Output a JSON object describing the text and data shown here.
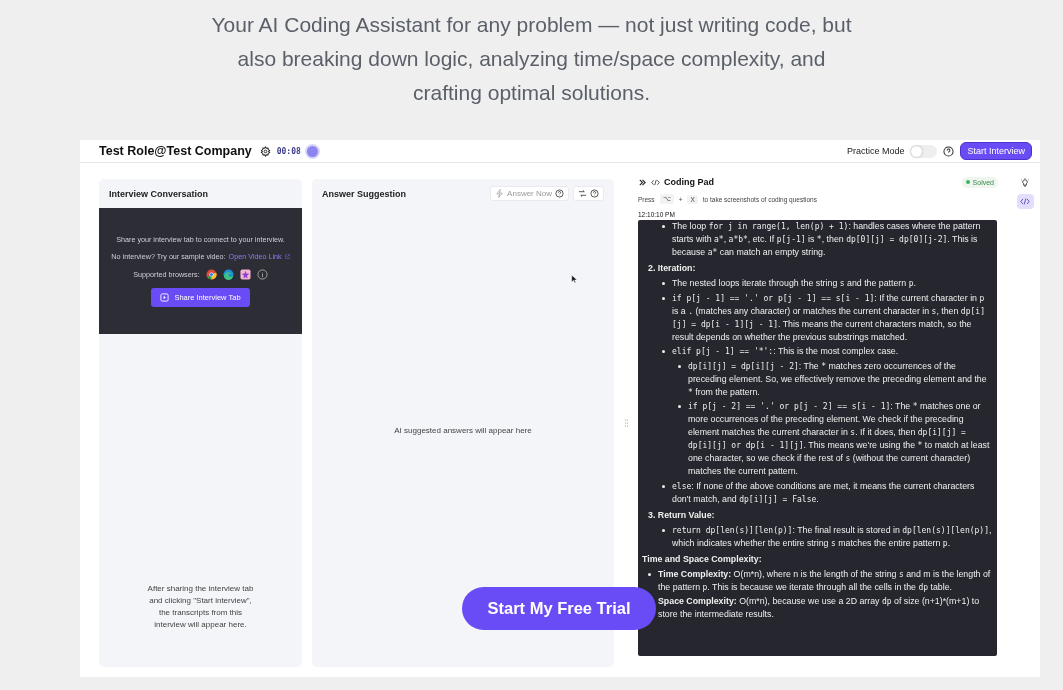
{
  "headline": "Your AI Coding Assistant for any problem — not just writing code, but also breaking down logic, analyzing time/space complexity, and crafting optimal solutions.",
  "top_bar": {
    "title": "Test Role@Test Company",
    "timer": "00:08",
    "recording": true,
    "practice_mode": {
      "label": "Practice Mode",
      "on": false
    },
    "start_button": "Start Interview"
  },
  "conversation": {
    "title": "Interview Conversation",
    "share_prompt": "Share your interview tab to connect to your interview.",
    "sample_prompt": "No interview? Try our sample video:",
    "sample_link": "Open Video Link",
    "browsers_label": "Supported browsers:",
    "share_button": "Share Interview Tab",
    "empty_text": "After sharing the interview tab and clicking \"Start interview\", the transcripts from this interview will appear here."
  },
  "suggestion": {
    "title": "Answer Suggestion",
    "answer_button": "Answer Now",
    "empty_text": "AI suggested answers will appear here"
  },
  "coding_pad": {
    "title": "Coding Pad",
    "status": "Solved",
    "hint": {
      "before": "Press",
      "keys": [
        "⌥",
        "X"
      ],
      "plus": "+",
      "after": "to take screenshots of coding questions"
    },
    "timestamp": "12:10:10 PM",
    "blocks": [
      {
        "kind": "list",
        "items": [
          {
            "segments": [
              {
                "kind": "text",
                "text": "The loop "
              },
              {
                "kind": "code",
                "text": "for j in range(1, len(p) + 1)"
              },
              {
                "kind": "text",
                "text": ": handles cases where the pattern starts with "
              },
              {
                "kind": "code",
                "text": "a*"
              },
              {
                "kind": "text",
                "text": ", "
              },
              {
                "kind": "code",
                "text": "a*b*"
              },
              {
                "kind": "text",
                "text": ", etc. If "
              },
              {
                "kind": "code",
                "text": "p[j-1]"
              },
              {
                "kind": "text",
                "text": " is "
              },
              {
                "kind": "code",
                "text": "*"
              },
              {
                "kind": "text",
                "text": ", then "
              },
              {
                "kind": "code",
                "text": "dp[0][j] = dp[0][j-2]"
              },
              {
                "kind": "text",
                "text": ". This is because "
              },
              {
                "kind": "code",
                "text": "a*"
              },
              {
                "kind": "text",
                "text": " can match an empty string."
              }
            ]
          }
        ]
      },
      {
        "kind": "step",
        "title": "2. Iteration:",
        "items": [
          {
            "segments": [
              {
                "kind": "text",
                "text": "The nested loops iterate through the string "
              },
              {
                "kind": "code",
                "text": "s"
              },
              {
                "kind": "text",
                "text": " and the pattern "
              },
              {
                "kind": "code",
                "text": "p"
              },
              {
                "kind": "text",
                "text": "."
              }
            ]
          },
          {
            "segments": [
              {
                "kind": "code",
                "text": "if p[j - 1] == '.' or p[j - 1] == s[i - 1]"
              },
              {
                "kind": "text",
                "text": ": If the current character in "
              },
              {
                "kind": "code",
                "text": "p"
              },
              {
                "kind": "text",
                "text": " is a "
              },
              {
                "kind": "code",
                "text": "."
              },
              {
                "kind": "text",
                "text": " (matches any character) or matches the current character in "
              },
              {
                "kind": "code",
                "text": "s"
              },
              {
                "kind": "text",
                "text": ", then "
              },
              {
                "kind": "code",
                "text": "dp[i][j] = dp[i - 1][j - 1]"
              },
              {
                "kind": "text",
                "text": ". This means the current characters match, so the result depends on whether the previous substrings matched."
              }
            ]
          },
          {
            "segments": [
              {
                "kind": "code",
                "text": "elif p[j - 1] == '*':"
              },
              {
                "kind": "text",
                "text": ": This is the most complex case."
              }
            ],
            "children": [
              {
                "segments": [
                  {
                    "kind": "code",
                    "text": "dp[i][j] = dp[i][j - 2]"
                  },
                  {
                    "kind": "text",
                    "text": ": The "
                  },
                  {
                    "kind": "code",
                    "text": "*"
                  },
                  {
                    "kind": "text",
                    "text": " matches zero occurrences of the preceding element. So, we effectively remove the preceding element and the "
                  },
                  {
                    "kind": "code",
                    "text": "*"
                  },
                  {
                    "kind": "text",
                    "text": " from the pattern."
                  }
                ]
              },
              {
                "segments": [
                  {
                    "kind": "code",
                    "text": "if p[j - 2] == '.' or p[j - 2] == s[i - 1]"
                  },
                  {
                    "kind": "text",
                    "text": ": The "
                  },
                  {
                    "kind": "code",
                    "text": "*"
                  },
                  {
                    "kind": "text",
                    "text": " matches one or more occurrences of the preceding element. We check if the preceding element matches the current character in "
                  },
                  {
                    "kind": "code",
                    "text": "s"
                  },
                  {
                    "kind": "text",
                    "text": ". If it does, then "
                  },
                  {
                    "kind": "code",
                    "text": "dp[i][j] = dp[i][j] or dp[i - 1][j]"
                  },
                  {
                    "kind": "text",
                    "text": ". This means we're using the "
                  },
                  {
                    "kind": "code",
                    "text": "*"
                  },
                  {
                    "kind": "text",
                    "text": " to match at least one character, so we check if the rest of "
                  },
                  {
                    "kind": "code",
                    "text": "s"
                  },
                  {
                    "kind": "text",
                    "text": " (without the current character) matches the current pattern."
                  }
                ]
              }
            ]
          },
          {
            "segments": [
              {
                "kind": "code",
                "text": "else"
              },
              {
                "kind": "text",
                "text": ": If none of the above conditions are met, it means the current characters don't match, and "
              },
              {
                "kind": "code",
                "text": "dp[i][j] = False"
              },
              {
                "kind": "text",
                "text": "."
              }
            ]
          }
        ]
      },
      {
        "kind": "step",
        "title": "3. Return Value:",
        "items": [
          {
            "segments": [
              {
                "kind": "code",
                "text": "return dp[len(s)][len(p)]"
              },
              {
                "kind": "text",
                "text": ": The final result is stored in "
              },
              {
                "kind": "code",
                "text": "dp[len(s)][len(p)]"
              },
              {
                "kind": "text",
                "text": ", which indicates whether the entire string "
              },
              {
                "kind": "code",
                "text": "s"
              },
              {
                "kind": "text",
                "text": " matches the entire pattern "
              },
              {
                "kind": "code",
                "text": "p"
              },
              {
                "kind": "text",
                "text": "."
              }
            ]
          }
        ]
      },
      {
        "kind": "section",
        "title": "Time and Space Complexity:",
        "items": [
          {
            "segments": [
              {
                "kind": "bold",
                "text": "Time Complexity:"
              },
              {
                "kind": "text",
                "text": " O(m*n), where n is the length of the string "
              },
              {
                "kind": "code",
                "text": "s"
              },
              {
                "kind": "text",
                "text": " and m is the length of the pattern "
              },
              {
                "kind": "code",
                "text": "p"
              },
              {
                "kind": "text",
                "text": ". This is because we iterate through all the cells in the "
              },
              {
                "kind": "code",
                "text": "dp"
              },
              {
                "kind": "text",
                "text": " table."
              }
            ]
          },
          {
            "segments": [
              {
                "kind": "bold",
                "text": "Space Complexity:"
              },
              {
                "kind": "text",
                "text": " O(m*n), because we use a 2D array "
              },
              {
                "kind": "code",
                "text": "dp"
              },
              {
                "kind": "text",
                "text": " of size (n+1)*(m+1) to store the intermediate results."
              }
            ]
          }
        ]
      }
    ]
  },
  "side_rail": [
    {
      "kind": "bulb",
      "selected": false
    },
    {
      "kind": "code",
      "selected": true
    }
  ],
  "cta_button": "Start My Free Trial"
}
